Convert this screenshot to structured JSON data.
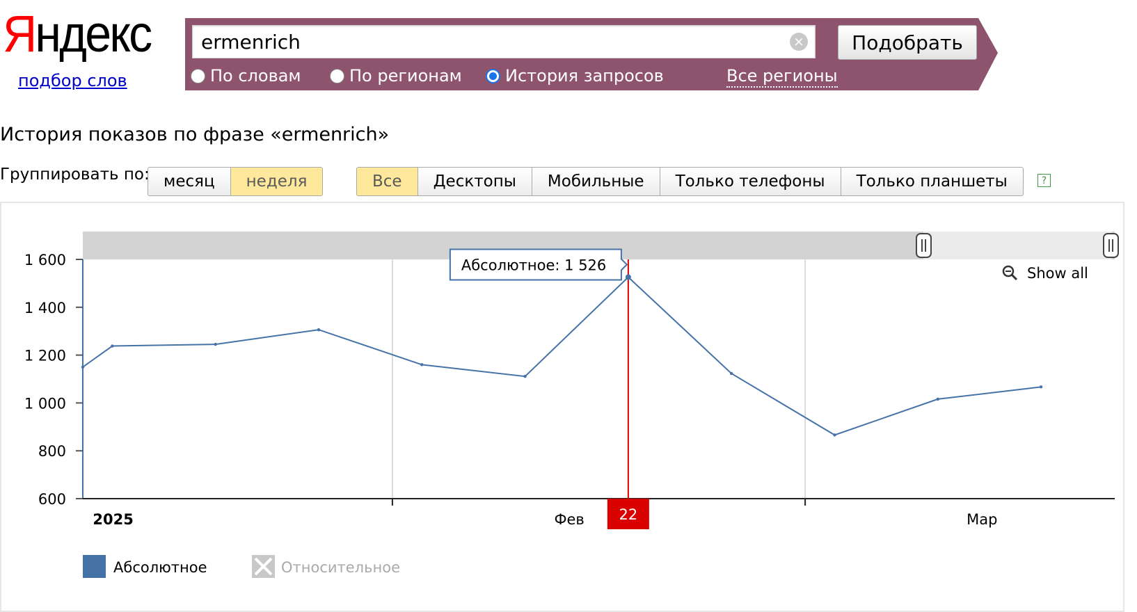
{
  "logo": {
    "text_first": "Я",
    "text_rest": "ндекс",
    "service_link": "подбор слов"
  },
  "search": {
    "query": "ermenrich",
    "submit_label": "Подобрать",
    "modes": [
      {
        "label": "По словам",
        "checked": false
      },
      {
        "label": "По регионам",
        "checked": false
      },
      {
        "label": "История запросов",
        "checked": true
      }
    ],
    "region_link": "Все регионы"
  },
  "page_title": "История показов по фразе «ermenrich»",
  "grouping": {
    "label": "Группировать по:",
    "options": [
      {
        "label": "месяц",
        "active": false
      },
      {
        "label": "неделя",
        "active": true
      }
    ]
  },
  "devices": {
    "options": [
      {
        "label": "Все",
        "active": true
      },
      {
        "label": "Десктопы",
        "active": false
      },
      {
        "label": "Мобильные",
        "active": false
      },
      {
        "label": "Только телефоны",
        "active": false
      },
      {
        "label": "Только планшеты",
        "active": false
      }
    ],
    "help_glyph": "?"
  },
  "chart": {
    "show_all_label": "Show all",
    "tooltip_text": "Абсолютное: 1 526",
    "crosshair_label": "22",
    "legend": [
      {
        "label": "Абсолютное",
        "enabled": true
      },
      {
        "label": "Относительное",
        "enabled": false
      }
    ],
    "colors": {
      "line": "#4572a7",
      "crosshair": "#d90000",
      "navigator": "#d3d3d3",
      "legend_disabled": "#aaaaaa"
    }
  },
  "chart_data": {
    "type": "line",
    "title": "",
    "xlabel": "",
    "ylabel": "",
    "ylim": [
      600,
      1600
    ],
    "y_ticks": [
      600,
      800,
      1000,
      1200,
      1400,
      1600
    ],
    "y_tick_labels": [
      "600",
      "800",
      "1 000",
      "1 200",
      "1 400",
      "1 600"
    ],
    "x_tick_labels": [
      {
        "label": "2025",
        "date": "2025-01-01",
        "bold": true
      },
      {
        "label": "Фев",
        "date": "2025-02-01",
        "bold": false
      },
      {
        "label": "Мар",
        "date": "2025-03-01",
        "bold": false
      }
    ],
    "x_range": [
      "2024-12-30",
      "2025-03-10"
    ],
    "grid": "vertical",
    "legend_position": "bottom-left",
    "series": [
      {
        "name": "Абсолютное",
        "points": [
          {
            "x": "2024-12-30",
            "y": 1150
          },
          {
            "x": "2025-01-01",
            "y": 1238
          },
          {
            "x": "2025-01-08",
            "y": 1245
          },
          {
            "x": "2025-01-15",
            "y": 1306
          },
          {
            "x": "2025-01-22",
            "y": 1160
          },
          {
            "x": "2025-01-29",
            "y": 1111
          },
          {
            "x": "2025-02-05",
            "y": 1526
          },
          {
            "x": "2025-02-12",
            "y": 1123
          },
          {
            "x": "2025-02-19",
            "y": 866
          },
          {
            "x": "2025-02-26",
            "y": 1016
          },
          {
            "x": "2025-03-05",
            "y": 1067
          }
        ]
      }
    ],
    "highlighted_point": {
      "x": "2025-02-05",
      "y": 1526
    }
  }
}
